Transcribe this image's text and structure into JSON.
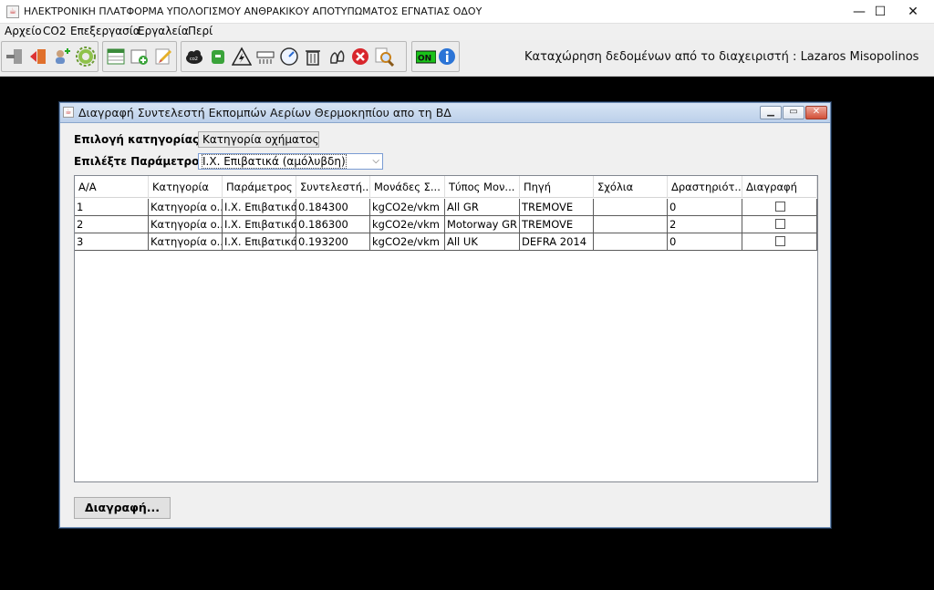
{
  "window": {
    "title": "ΗΛΕΚΤΡΟΝΙΚΗ ΠΛΑΤΦΟΡΜΑ ΥΠΟΛΟΓΙΣΜΟΥ ΑΝΘΡΑΚΙΚΟΥ ΑΠΟΤΥΠΩΜΑΤΟΣ ΕΓΝΑΤΙΑΣ ΟΔΟΥ",
    "minimize": "—",
    "maximize": "☐",
    "close": "✕"
  },
  "menu": {
    "items": [
      "Αρχείο",
      "CO2",
      "Επεξεργασία",
      "Εργαλεία",
      "Περί"
    ]
  },
  "toolbar": {
    "status": "Καταχώρηση δεδομένων από το διαχειριστή : Lazaros Misopolinos",
    "on_label": "ON",
    "co2_label": "co2"
  },
  "dialog": {
    "title": "Διαγραφή Συντελεστή Εκπομπών Αερίων Θερμοκηπίου απο τη ΒΔ",
    "category_label": "Επιλογή κατηγορίας :",
    "category_value": "Κατηγορία οχήματος",
    "param_label": "Επιλέξτε Παράμετρο :",
    "param_value": "Ι.Χ. Επιβατικά (αμόλυβδη)",
    "columns": [
      "Α/Α",
      "Κατηγορία",
      "Παράμετρος",
      "Συντελεστή...",
      "Μονάδες Σ...",
      "Τύπος Μον...",
      "Πηγή",
      "Σχόλια",
      "Δραστηριότ...",
      "Διαγραφή"
    ],
    "rows": [
      {
        "aa": "1",
        "cat": "Κατηγορία ο...",
        "param": "Ι.Χ. Επιβατικά...",
        "coef": "0.184300",
        "units": "kgCO2e/vkm",
        "type": "All GR",
        "source": "TREMOVE",
        "comments": "",
        "activity": "0",
        "delete": false
      },
      {
        "aa": "2",
        "cat": "Κατηγορία ο...",
        "param": "Ι.Χ. Επιβατικά...",
        "coef": "0.186300",
        "units": "kgCO2e/vkm",
        "type": "Motorway GR",
        "source": "TREMOVE",
        "comments": "",
        "activity": "2",
        "delete": false
      },
      {
        "aa": "3",
        "cat": "Κατηγορία ο...",
        "param": "Ι.Χ. Επιβατικά...",
        "coef": "0.193200",
        "units": "kgCO2e/vkm",
        "type": "All UK",
        "source": "DEFRA 2014",
        "comments": "",
        "activity": "0",
        "delete": false
      }
    ],
    "delete_button": "Διαγραφή..."
  }
}
